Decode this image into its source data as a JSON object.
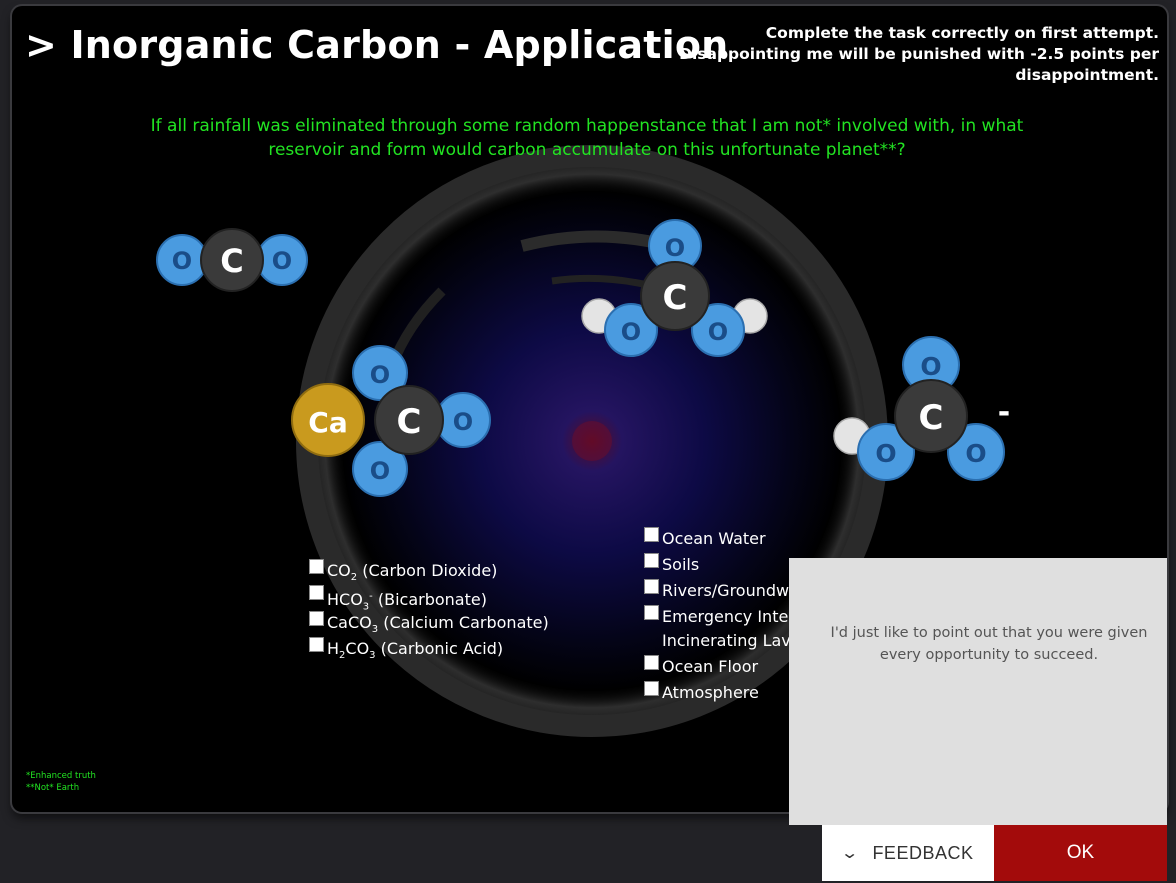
{
  "header": {
    "title": "> Inorganic Carbon - Application",
    "warning": "Complete the task correctly on first attempt.  Disappointing me will be punished with -2.5 points per disappointment."
  },
  "question": "If all rainfall was eliminated through some random happenstance that I am not* involved with, in what reservoir and form would carbon accumulate on this unfortunate planet**?",
  "molecules": {
    "atoms": {
      "oxygen": "O",
      "carbon": "C",
      "calcium": "Ca"
    },
    "charge": "-"
  },
  "forms": [
    {
      "formula": "CO",
      "sub": "2",
      "sup": "",
      "tail": "",
      "name": " (Carbon Dioxide)",
      "checked": false
    },
    {
      "formula": "HCO",
      "sub": "3",
      "sup": "-",
      "tail": "",
      "name": " (Bicarbonate)",
      "checked": false
    },
    {
      "formula": "CaCO",
      "sub": "3",
      "sup": "",
      "tail": "",
      "name": " (Calcium Carbonate)",
      "checked": false
    },
    {
      "formula": "H",
      "sub": "2",
      "sup": "",
      "tail": "CO",
      "sub2": "3",
      "name": " (Carbonic Acid)",
      "checked": false
    }
  ],
  "reservoirs": [
    {
      "label": "Ocean Water",
      "checked": false
    },
    {
      "label": "Soils",
      "checked": false
    },
    {
      "label": "Rivers/Groundwa",
      "checked": false
    },
    {
      "label": "Emergency Intell",
      "label2": "Incinerating Lava",
      "checked": false
    },
    {
      "label": "Ocean Floor",
      "checked": false
    },
    {
      "label": "Atmosphere",
      "checked": false
    }
  ],
  "footnotes": {
    "line1": "*Enhanced truth",
    "line2": "**Not* Earth"
  },
  "feedback": {
    "message": "I'd just like to point out that you were given every opportunity to succeed.",
    "feedback_label": "FEEDBACK",
    "ok_label": "OK"
  },
  "colors": {
    "accent_green": "#22e322",
    "ok_red": "#a30b0b",
    "oxygen_blue": "#4a9be0",
    "carbon_gray": "#3a3a3a",
    "calcium_gold": "#c99a1e"
  }
}
